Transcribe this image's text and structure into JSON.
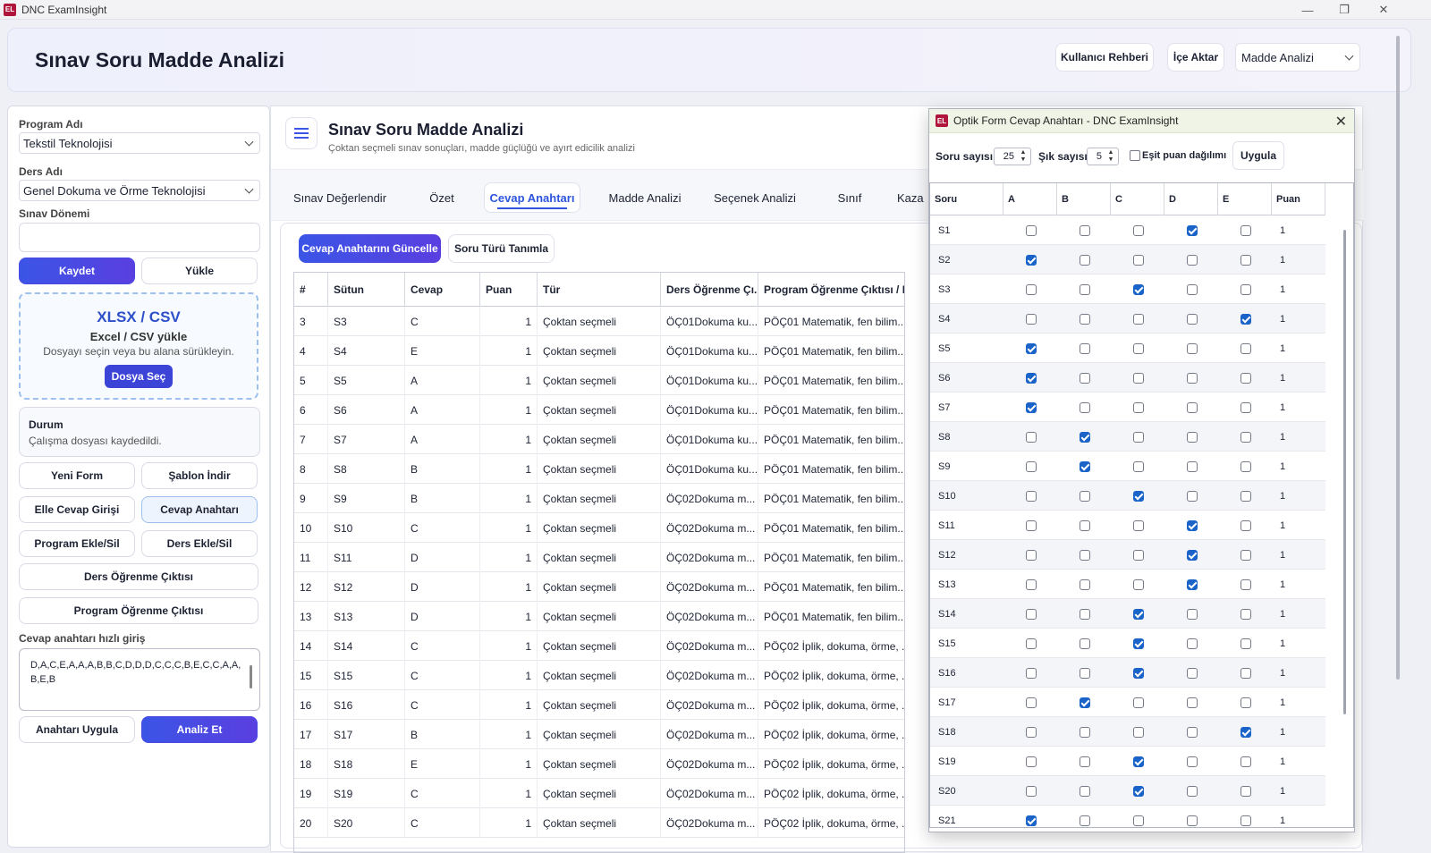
{
  "window": {
    "title": "DNC ExamInsight",
    "logo": "EL",
    "min": "—",
    "max": "❐",
    "close": "✕"
  },
  "header": {
    "title": "Sınav Soru Madde Analizi",
    "guide": "Kullanıcı Rehberi",
    "import": "İçe Aktar",
    "view_select": "Madde Analizi"
  },
  "sidebar": {
    "program_label": "Program Adı",
    "program_value": "Tekstil Teknolojisi",
    "course_label": "Ders Adı",
    "course_value": "Genel Dokuma ve Örme Teknolojisi",
    "period_label": "Sınav Dönemi",
    "period_value": "",
    "save": "Kaydet",
    "load": "Yükle",
    "drop_title": "XLSX / CSV",
    "drop_sub": "Excel / CSV yükle",
    "drop_hint": "Dosyayı seçin veya bu alana sürükleyin.",
    "drop_button": "Dosya Seç",
    "status_title": "Durum",
    "status_text": "Çalışma dosyası kaydedildi.",
    "new_form": "Yeni Form",
    "download_template": "Şablon İndir",
    "manual_entry": "Elle Cevap Girişi",
    "answer_key": "Cevap Anahtarı",
    "program_add": "Program Ekle/Sil",
    "course_add": "Ders Ekle/Sil",
    "course_outcome": "Ders Öğrenme Çıktısı",
    "program_outcome": "Program Öğrenme Çıktısı",
    "quick_label": "Cevap anahtarı hızlı giriş",
    "quick_value": "D,A,C,E,A,A,A,B,B,C,D,D,D,C,C,C,B,E,C,C,A,A,B,E,B",
    "apply_key": "Anahtarı Uygula",
    "analyze": "Analiz Et"
  },
  "main": {
    "title": "Sınav Soru Madde Analizi",
    "subtitle": "Çoktan seçmeli sınav sonuçları, madde güçlüğü ve ayırt edicilik analizi",
    "tabs": [
      "Sınav Değerlendir",
      "Özet",
      "Cevap Anahtarı",
      "Madde Analizi",
      "Seçenek Analizi",
      "Sınıf",
      "Kaza"
    ],
    "update_key": "Cevap Anahtarını Güncelle",
    "define_type": "Soru Türü Tanımla",
    "columns": [
      "#",
      "Sütun",
      "Cevap",
      "Puan",
      "Tür",
      "Ders Öğrenme Çı...",
      "Program Öğrenme Çıktısı / K..."
    ],
    "rows": [
      [
        "3",
        "S3",
        "C",
        "1",
        "Çoktan seçmeli",
        "ÖÇ01Dokuma ku...",
        "PÖÇ01 Matematik, fen bilim..."
      ],
      [
        "4",
        "S4",
        "E",
        "1",
        "Çoktan seçmeli",
        "ÖÇ01Dokuma ku...",
        "PÖÇ01 Matematik, fen bilim..."
      ],
      [
        "5",
        "S5",
        "A",
        "1",
        "Çoktan seçmeli",
        "ÖÇ01Dokuma ku...",
        "PÖÇ01 Matematik, fen bilim..."
      ],
      [
        "6",
        "S6",
        "A",
        "1",
        "Çoktan seçmeli",
        "ÖÇ01Dokuma ku...",
        "PÖÇ01 Matematik, fen bilim..."
      ],
      [
        "7",
        "S7",
        "A",
        "1",
        "Çoktan seçmeli",
        "ÖÇ01Dokuma ku...",
        "PÖÇ01 Matematik, fen bilim..."
      ],
      [
        "8",
        "S8",
        "B",
        "1",
        "Çoktan seçmeli",
        "ÖÇ01Dokuma ku...",
        "PÖÇ01 Matematik, fen bilim..."
      ],
      [
        "9",
        "S9",
        "B",
        "1",
        "Çoktan seçmeli",
        "ÖÇ02Dokuma m...",
        "PÖÇ01 Matematik, fen bilim..."
      ],
      [
        "10",
        "S10",
        "C",
        "1",
        "Çoktan seçmeli",
        "ÖÇ02Dokuma m...",
        "PÖÇ01 Matematik, fen bilim..."
      ],
      [
        "11",
        "S11",
        "D",
        "1",
        "Çoktan seçmeli",
        "ÖÇ02Dokuma m...",
        "PÖÇ01 Matematik, fen bilim..."
      ],
      [
        "12",
        "S12",
        "D",
        "1",
        "Çoktan seçmeli",
        "ÖÇ02Dokuma m...",
        "PÖÇ01 Matematik, fen bilim..."
      ],
      [
        "13",
        "S13",
        "D",
        "1",
        "Çoktan seçmeli",
        "ÖÇ02Dokuma m...",
        "PÖÇ01 Matematik, fen bilim..."
      ],
      [
        "14",
        "S14",
        "C",
        "1",
        "Çoktan seçmeli",
        "ÖÇ02Dokuma m...",
        "PÖÇ02 İplik, dokuma, örme, ..."
      ],
      [
        "15",
        "S15",
        "C",
        "1",
        "Çoktan seçmeli",
        "ÖÇ02Dokuma m...",
        "PÖÇ02 İplik, dokuma, örme, ..."
      ],
      [
        "16",
        "S16",
        "C",
        "1",
        "Çoktan seçmeli",
        "ÖÇ02Dokuma m...",
        "PÖÇ02 İplik, dokuma, örme, ..."
      ],
      [
        "17",
        "S17",
        "B",
        "1",
        "Çoktan seçmeli",
        "ÖÇ02Dokuma m...",
        "PÖÇ02 İplik, dokuma, örme, ..."
      ],
      [
        "18",
        "S18",
        "E",
        "1",
        "Çoktan seçmeli",
        "ÖÇ02Dokuma m...",
        "PÖÇ02 İplik, dokuma, örme, ..."
      ],
      [
        "19",
        "S19",
        "C",
        "1",
        "Çoktan seçmeli",
        "ÖÇ02Dokuma m...",
        "PÖÇ02 İplik, dokuma, örme, ..."
      ],
      [
        "20",
        "S20",
        "C",
        "1",
        "Çoktan seçmeli",
        "ÖÇ02Dokuma m...",
        "PÖÇ02 İplik, dokuma, örme, ..."
      ]
    ]
  },
  "dialog": {
    "title": "Optik Form Cevap Anahtarı - DNC ExamInsight",
    "close": "✕",
    "q_count_label": "Soru sayısı",
    "q_count": "25",
    "opt_count_label": "Şık sayısı",
    "opt_count": "5",
    "equal_label": "Eşit puan dağılımı",
    "apply": "Uygula",
    "columns": [
      "Soru",
      "A",
      "B",
      "C",
      "D",
      "E",
      "Puan"
    ],
    "rows": [
      {
        "q": "S1",
        "ans": "D",
        "p": "1"
      },
      {
        "q": "S2",
        "ans": "A",
        "p": "1"
      },
      {
        "q": "S3",
        "ans": "C",
        "p": "1"
      },
      {
        "q": "S4",
        "ans": "E",
        "p": "1"
      },
      {
        "q": "S5",
        "ans": "A",
        "p": "1"
      },
      {
        "q": "S6",
        "ans": "A",
        "p": "1"
      },
      {
        "q": "S7",
        "ans": "A",
        "p": "1"
      },
      {
        "q": "S8",
        "ans": "B",
        "p": "1"
      },
      {
        "q": "S9",
        "ans": "B",
        "p": "1"
      },
      {
        "q": "S10",
        "ans": "C",
        "p": "1"
      },
      {
        "q": "S11",
        "ans": "D",
        "p": "1"
      },
      {
        "q": "S12",
        "ans": "D",
        "p": "1"
      },
      {
        "q": "S13",
        "ans": "D",
        "p": "1"
      },
      {
        "q": "S14",
        "ans": "C",
        "p": "1"
      },
      {
        "q": "S15",
        "ans": "C",
        "p": "1"
      },
      {
        "q": "S16",
        "ans": "C",
        "p": "1"
      },
      {
        "q": "S17",
        "ans": "B",
        "p": "1"
      },
      {
        "q": "S18",
        "ans": "E",
        "p": "1"
      },
      {
        "q": "S19",
        "ans": "C",
        "p": "1"
      },
      {
        "q": "S20",
        "ans": "C",
        "p": "1"
      },
      {
        "q": "S21",
        "ans": "A",
        "p": "1"
      }
    ]
  },
  "colors": {
    "accent": "#3b55e6",
    "checked": "#1a63c8",
    "logo": "#b0163c"
  }
}
